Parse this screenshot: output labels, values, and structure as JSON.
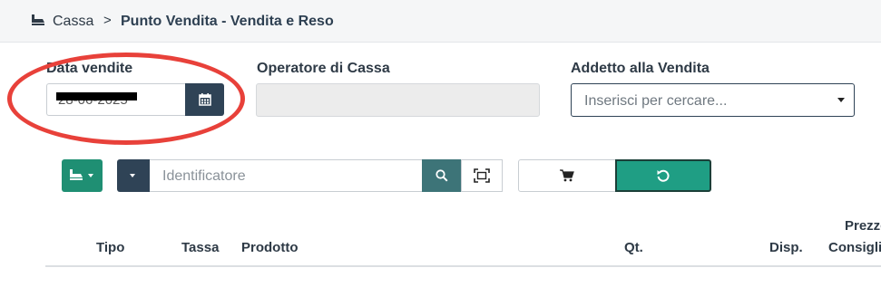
{
  "breadcrumb": {
    "icon": "cash-register-icon",
    "home": "Cassa",
    "separator": ">",
    "current": "Punto Vendita - Vendita e Reso"
  },
  "form": {
    "data_vendite_label": "Data vendite",
    "data_vendite_value": "28-06-2025",
    "operatore_label": "Operatore di Cassa",
    "operatore_value": "",
    "addetto_label": "Addetto alla Vendita",
    "addetto_placeholder": "Inserisci per cercare..."
  },
  "toolbar": {
    "identifier_placeholder": "Identificatore"
  },
  "table": {
    "headers": {
      "tipo": "Tipo",
      "tassa": "Tassa",
      "prodotto": "Prodotto",
      "qt": "Qt.",
      "disp": "Disp.",
      "prezzo_line1": "Prezzo",
      "prezzo_line2": "Consigliato"
    }
  },
  "colors": {
    "primary_dark": "#2f4356",
    "teal": "#1f9e84",
    "annotation_red": "#e8413a"
  }
}
